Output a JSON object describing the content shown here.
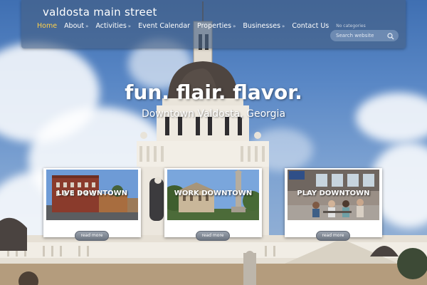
{
  "site": {
    "title": "valdosta main street"
  },
  "nav": {
    "items": [
      {
        "label": "Home",
        "active": true,
        "has_submenu": false
      },
      {
        "label": "About",
        "active": false,
        "has_submenu": true
      },
      {
        "label": "Activities",
        "active": false,
        "has_submenu": true
      },
      {
        "label": "Event Calendar",
        "active": false,
        "has_submenu": false
      },
      {
        "label": "Properties",
        "active": false,
        "has_submenu": true
      },
      {
        "label": "Businesses",
        "active": false,
        "has_submenu": true
      },
      {
        "label": "Contact Us",
        "active": false,
        "has_submenu": false
      }
    ],
    "submenu_arrow": "»",
    "no_categories": "No categories"
  },
  "search": {
    "placeholder": "Search website",
    "icon": "magnifier-icon"
  },
  "hero": {
    "title": "fun. flair. flavor.",
    "subtitle": "Downtown Valdosta, Georgia"
  },
  "cards": [
    {
      "label": "LIVE DOWNTOWN",
      "button": "read more",
      "photo": "brick-building-street"
    },
    {
      "label": "WORK DOWNTOWN",
      "button": "read more",
      "photo": "courthouse-monument"
    },
    {
      "label": "PLAY DOWNTOWN",
      "button": "read more",
      "photo": "outdoor-cafe-diners"
    }
  ],
  "colors": {
    "active_nav": "#ffd24a",
    "header_bg": "rgba(70,95,130,0.62)",
    "text": "#ffffff"
  }
}
